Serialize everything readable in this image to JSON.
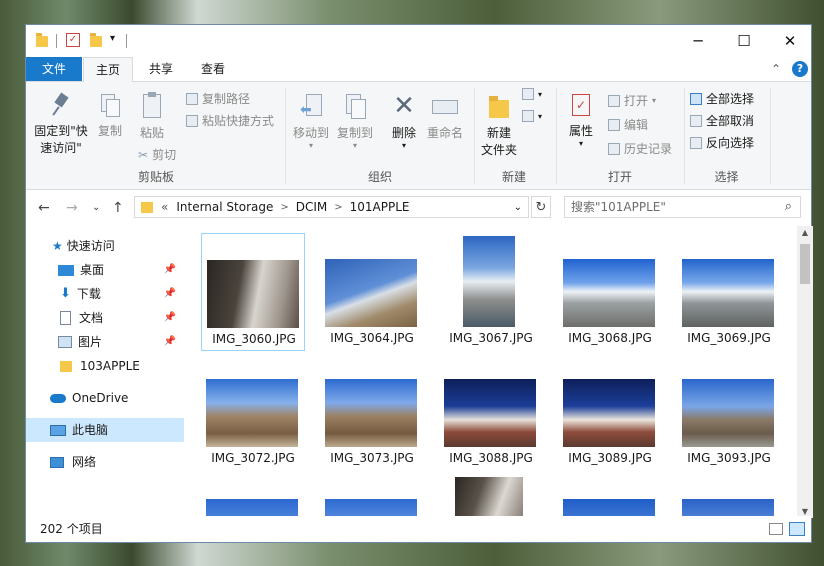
{
  "titlebar": {
    "minimize": "─",
    "maximize": "☐",
    "close": "✕",
    "dropdown": "▾"
  },
  "menu": {
    "file": "文件",
    "home": "主页",
    "share": "共享",
    "view": "查看",
    "collapse": "⌃",
    "help": "?"
  },
  "ribbon": {
    "pin_label_1": "固定到\"快",
    "pin_label_2": "速访问\"",
    "copy": "复制",
    "paste": "粘贴",
    "copy_path": "复制路径",
    "paste_shortcut": "粘贴快捷方式",
    "cut": "剪切",
    "clipboard_group": "剪贴板",
    "move_to": "移动到",
    "copy_to": "复制到",
    "delete": "删除",
    "rename": "重命名",
    "organize_group": "组织",
    "new_folder_1": "新建",
    "new_folder_2": "文件夹",
    "new_group": "新建",
    "properties": "属性",
    "open": "打开",
    "edit": "编辑",
    "history": "历史记录",
    "open_group": "打开",
    "select_all": "全部选择",
    "select_none": "全部取消",
    "invert_selection": "反向选择",
    "select_group": "选择"
  },
  "address": {
    "back": "←",
    "forward": "→",
    "recent": "⌄",
    "up": "↑",
    "overflow": "«",
    "crumbs": [
      "Internal Storage",
      "DCIM",
      "101APPLE"
    ],
    "dropdown": "⌄",
    "refresh": "↻",
    "search_placeholder": "搜索\"101APPLE\"",
    "search_icon": "⌕"
  },
  "nav": {
    "quick_access": "快速访问",
    "desktop": "桌面",
    "downloads": "下载",
    "documents": "文档",
    "pictures": "图片",
    "folder_103": "103APPLE",
    "onedrive": "OneDrive",
    "this_pc": "此电脑",
    "network": "网络"
  },
  "files": [
    {
      "name": "IMG_3060.JPG"
    },
    {
      "name": "IMG_3064.JPG"
    },
    {
      "name": "IMG_3067.JPG"
    },
    {
      "name": "IMG_3068.JPG"
    },
    {
      "name": "IMG_3069.JPG"
    },
    {
      "name": "IMG_3072.JPG"
    },
    {
      "name": "IMG_3073.JPG"
    },
    {
      "name": "IMG_3088.JPG"
    },
    {
      "name": "IMG_3089.JPG"
    },
    {
      "name": "IMG_3093.JPG"
    }
  ],
  "status": {
    "count": "202 个项目"
  },
  "colors": {
    "accent": "#1979ca",
    "selection": "#cce8ff"
  }
}
